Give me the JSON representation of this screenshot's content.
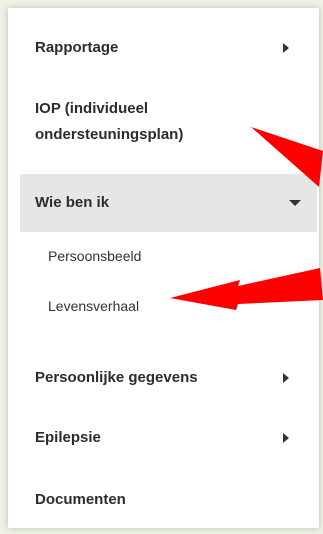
{
  "menu": {
    "rapportage": "Rapportage",
    "iop_line1": "IOP (individueel",
    "iop_line2": "ondersteuningsplan)",
    "wie_ben_ik": "Wie ben ik",
    "sub_items": [
      "Persoonsbeeld",
      "Levensverhaal"
    ],
    "persoonlijke": "Persoonlijke gegevens",
    "epilepsie": "Epilepsie",
    "documenten": "Documenten"
  },
  "colors": {
    "annotation_arrow": "#ff0000",
    "active_bg": "#e6e6e6",
    "text": "#2c2c2c"
  },
  "icons": [
    "chevron-right-icon",
    "chevron-down-icon",
    "annotation-arrow-icon"
  ]
}
